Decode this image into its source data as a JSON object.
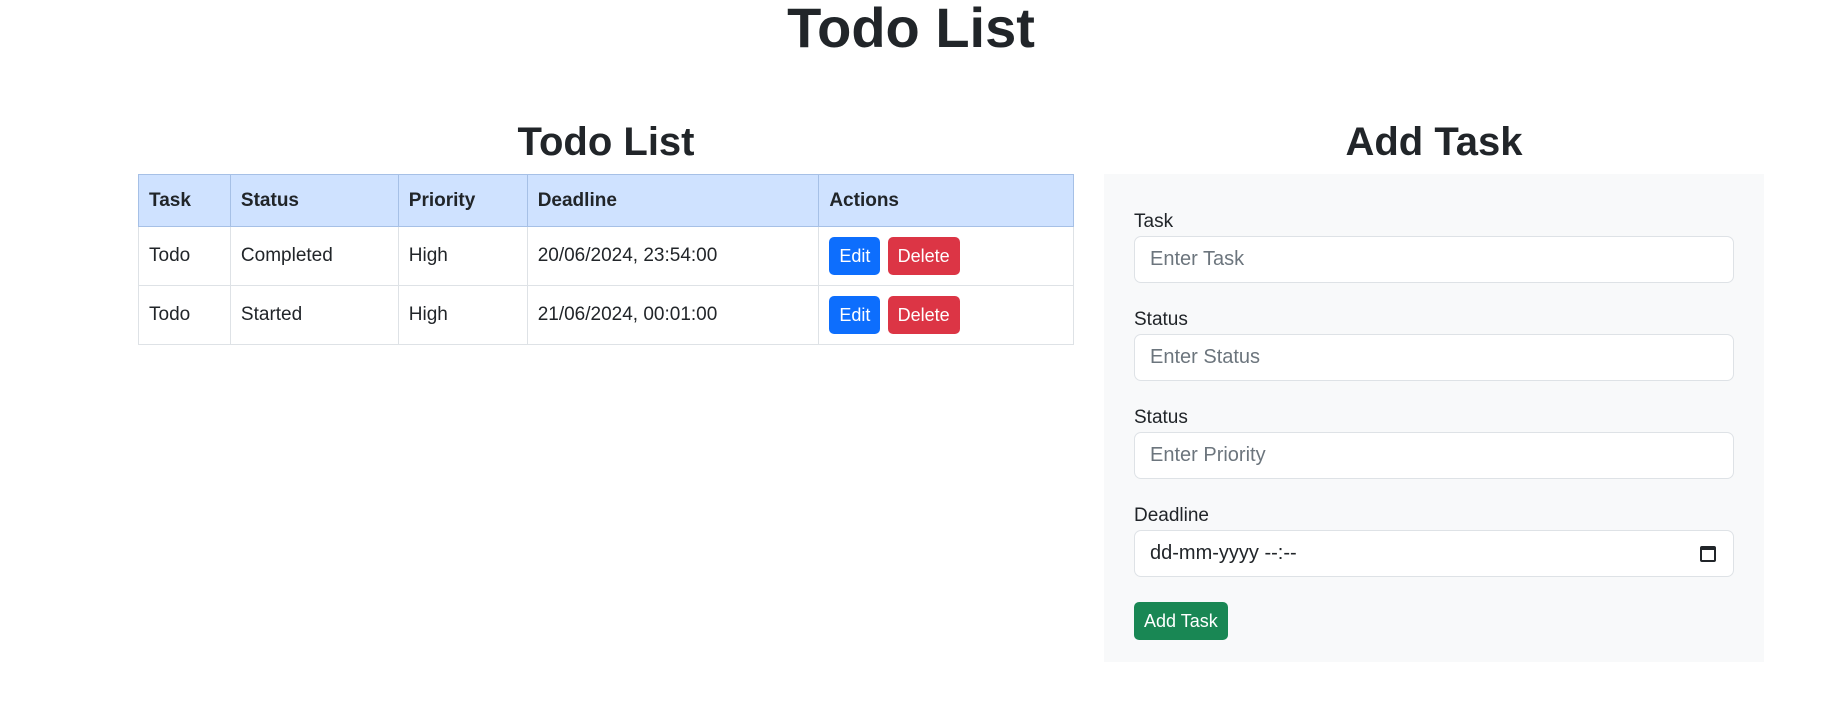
{
  "page": {
    "title": "Todo List"
  },
  "list": {
    "title": "Todo List",
    "columns": [
      "Task",
      "Status",
      "Priority",
      "Deadline",
      "Actions"
    ],
    "rows": [
      {
        "task": "Todo",
        "status": "Completed",
        "priority": "High",
        "deadline": "20/06/2024, 23:54:00"
      },
      {
        "task": "Todo",
        "status": "Started",
        "priority": "High",
        "deadline": "21/06/2024, 00:01:00"
      }
    ],
    "edit_label": "Edit",
    "delete_label": "Delete"
  },
  "form": {
    "title": "Add Task",
    "fields": [
      {
        "label": "Task",
        "placeholder": "Enter Task"
      },
      {
        "label": "Status",
        "placeholder": "Enter Status"
      },
      {
        "label": "Status",
        "placeholder": "Enter Priority"
      }
    ],
    "deadline_label": "Deadline",
    "deadline_value": "dd-mm-yyyy --:--",
    "submit_label": "Add Task"
  },
  "colors": {
    "header_bg": "#cfe2ff",
    "edit": "#0d6efd",
    "delete": "#dc3545",
    "add": "#198754",
    "form_bg": "#f8f9fa"
  },
  "icons": {
    "deadline_picker": "calendar-icon"
  }
}
